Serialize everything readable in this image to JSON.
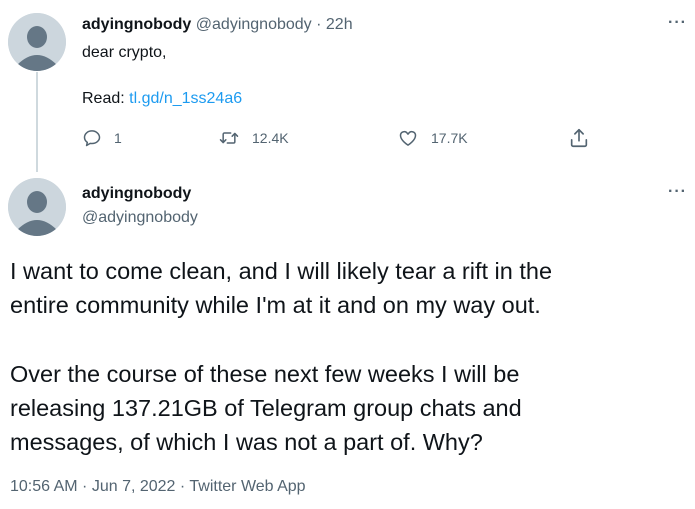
{
  "tweet1": {
    "display_name": "adyingnobody",
    "handle": "@adyingnobody",
    "separator": "·",
    "time": "22h",
    "body": "dear crypto,",
    "read_label": "Read: ",
    "link": "tl.gd/n_1ss24a6",
    "actions": {
      "replies": "1",
      "retweets": "12.4K",
      "likes": "17.7K"
    }
  },
  "tweet2": {
    "display_name": "adyingnobody",
    "handle": "@adyingnobody",
    "lines": [
      "I want to come clean, and I will likely tear a rift in the",
      "entire community while I'm at it and on my way out.",
      "Over the course of these next few weeks I will be",
      "releasing 137.21GB of Telegram group chats and",
      "messages, of which I was not a part of. Why?"
    ],
    "timestamp": "10:56 AM · Jun 7, 2022 · Twitter Web App"
  },
  "icons": {
    "more": "more-horizontal-icon",
    "reply": "reply-icon",
    "retweet": "retweet-icon",
    "like": "heart-icon",
    "share": "share-icon",
    "avatar": "default-avatar-icon"
  },
  "colors": {
    "link": "#1d9bf0",
    "muted": "#536471",
    "text": "#0f1419",
    "avatar_bg": "#ccd6dd",
    "avatar_fg": "#657786",
    "thread_line": "#cfd9de"
  }
}
